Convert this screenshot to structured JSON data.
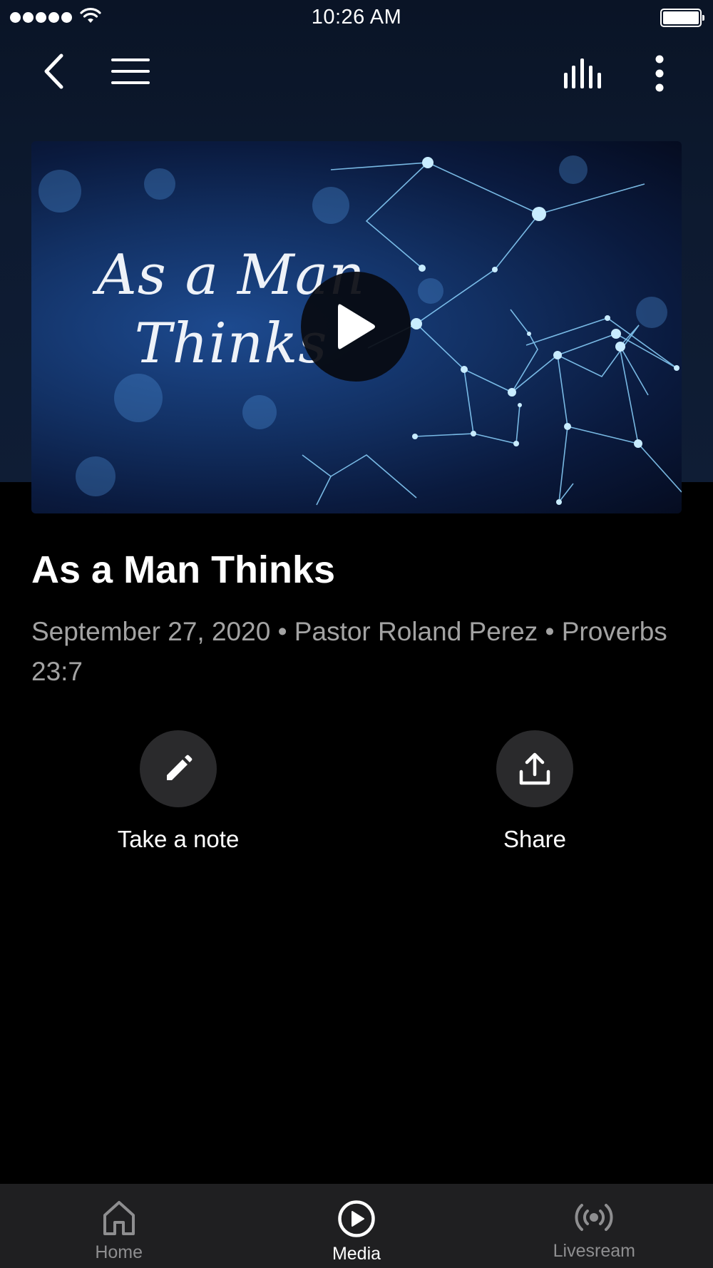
{
  "status_bar": {
    "time": "10:26 AM",
    "signal_icon": "signal-dots-icon",
    "wifi_icon": "wifi-icon",
    "battery_icon": "battery-icon",
    "battery_level": 1.0
  },
  "nav": {
    "back_icon": "chevron-left-icon",
    "menu_icon": "hamburger-menu-icon",
    "audio_icon": "audio-bars-icon",
    "more_icon": "vertical-ellipsis-icon"
  },
  "video": {
    "thumbnail_text_line1": "As a Man",
    "thumbnail_text_line2": "Thinks",
    "play_icon": "play-icon"
  },
  "sermon": {
    "title": "As a Man Thinks",
    "meta": "September 27, 2020 • Pastor Roland Perez • Proverbs 23:7"
  },
  "actions": {
    "note_label": "Take a note",
    "note_icon": "pencil-icon",
    "share_label": "Share",
    "share_icon": "share-upload-icon"
  },
  "tabs": [
    {
      "label": "Home",
      "icon": "home-icon",
      "active": false
    },
    {
      "label": "Media",
      "icon": "play-circle-icon",
      "active": true
    },
    {
      "label": "Livesream",
      "icon": "broadcast-icon",
      "active": false
    }
  ],
  "colors": {
    "header_bg": "#0d1a30",
    "page_bg": "#000000",
    "tab_bar_bg": "#1f1f21",
    "meta_text": "#a3a3a3",
    "action_circle": "#2a2a2c"
  }
}
